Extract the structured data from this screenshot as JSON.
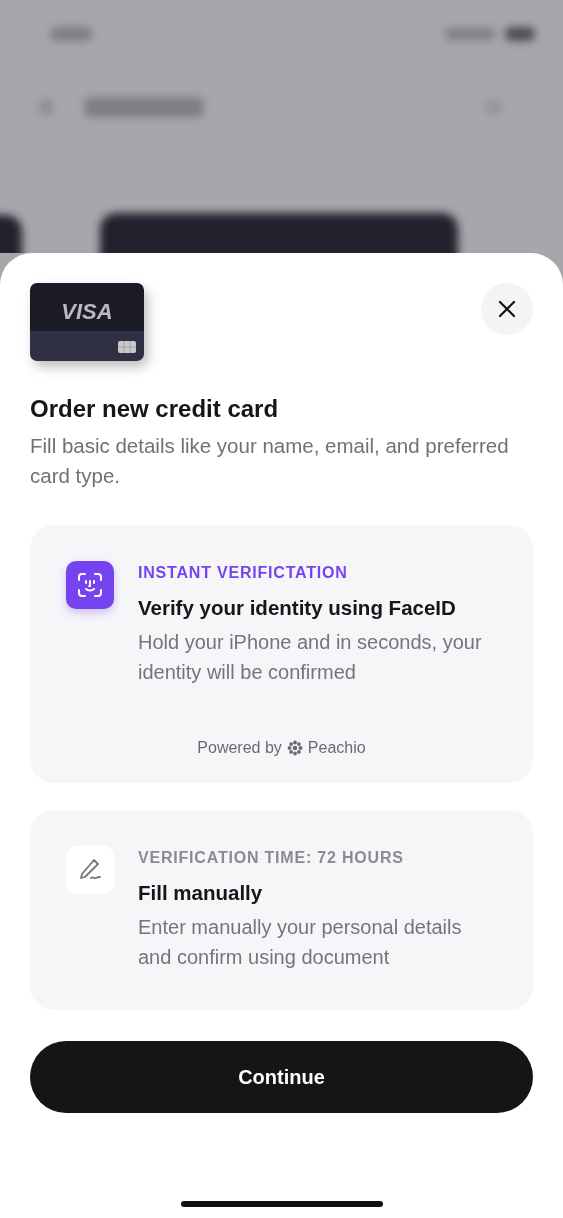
{
  "card": {
    "brand": "VISA"
  },
  "title": "Order new credit card",
  "description": "Fill basic details like your name, email, and preferred card type.",
  "options": [
    {
      "kind": "faceid",
      "label": "INSTANT VERIFICTATION",
      "title": "Verify your identity using FaceID",
      "description": "Hold your iPhone and in seconds, your identity will be confirmed",
      "footer": {
        "prefix": "Powered by",
        "brand": "Peachio"
      }
    },
    {
      "kind": "manual",
      "label": "VERIFICATION TIME: 72 HOURS",
      "title": "Fill manually",
      "description": "Enter manually your personal details and confirm using document"
    }
  ],
  "button": "Continue"
}
